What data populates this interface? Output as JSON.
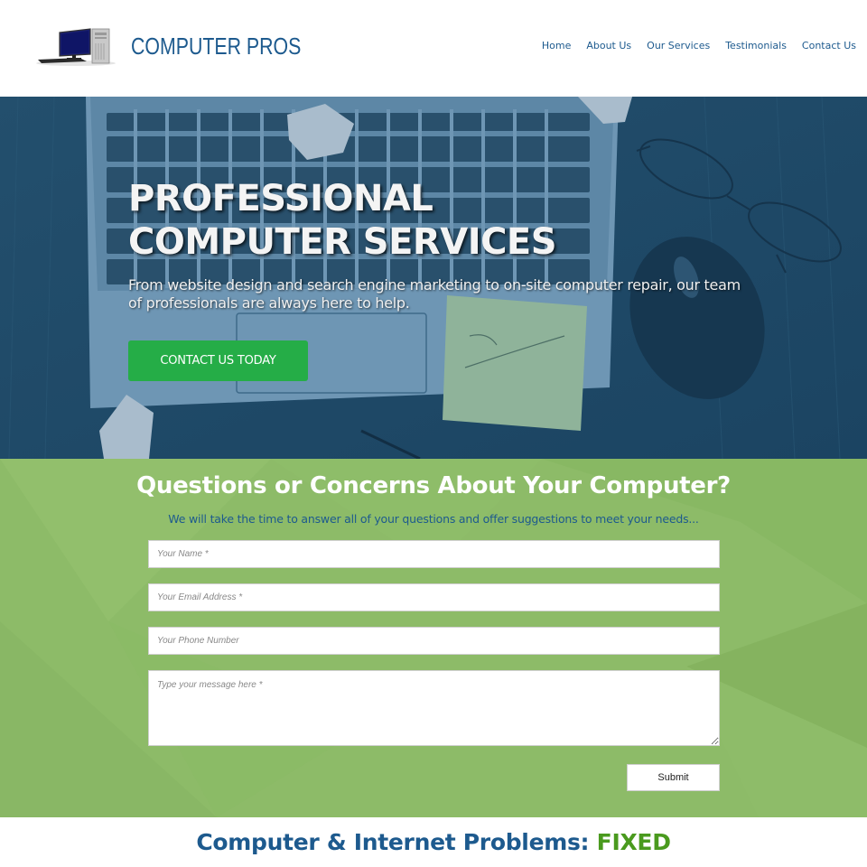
{
  "header": {
    "brand": "COMPUTER PROS",
    "logo_icon": "desktop-computer-icon",
    "nav": [
      {
        "label": "Home"
      },
      {
        "label": "About Us"
      },
      {
        "label": "Our Services"
      },
      {
        "label": "Testimonials"
      },
      {
        "label": "Contact Us"
      }
    ]
  },
  "hero": {
    "title_line1": "PROFESSIONAL",
    "title_line2": "COMPUTER SERVICES",
    "subtitle": "From website design and search engine marketing to on-site computer repair, our team of professionals are always here to help.",
    "cta_label": "CONTACT US TODAY",
    "background_image": "laptop-keyboard-glasses-mouse-help-note-photo"
  },
  "contact": {
    "title": "Questions or Concerns About Your Computer?",
    "subtitle": "We will take the time to answer all of your questions and offer suggestions to meet your needs...",
    "fields": {
      "name": {
        "placeholder": "Your Name *",
        "value": ""
      },
      "email": {
        "placeholder": "Your Email Address *",
        "value": ""
      },
      "phone": {
        "placeholder": "Your Phone Number",
        "value": ""
      },
      "message": {
        "placeholder": "Type your message here *",
        "value": ""
      }
    },
    "submit_label": "Submit"
  },
  "problems": {
    "heading_main": "Computer & Internet Problems: ",
    "heading_accent": "FIXED"
  },
  "colors": {
    "brand_blue": "#1d5a8e",
    "cta_green": "#25ad47",
    "section_green": "#8dbb68",
    "accent_green": "#4a9a1e",
    "hero_overlay": "#1f4a68"
  }
}
